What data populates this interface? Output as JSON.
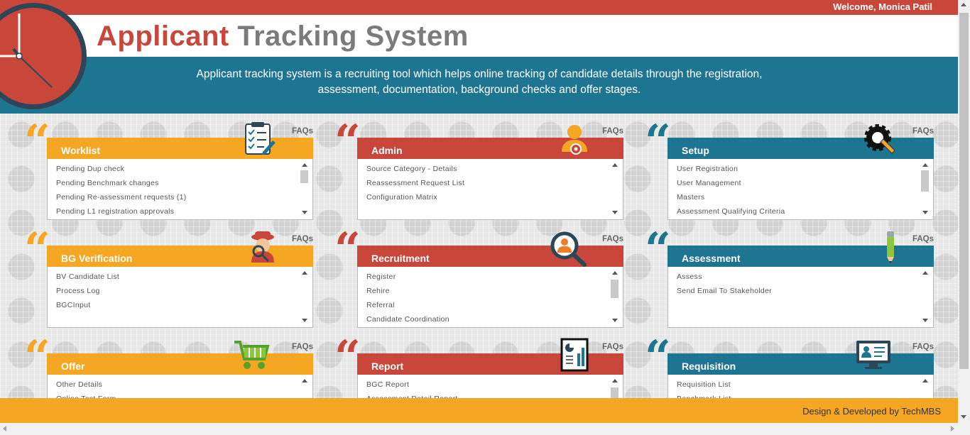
{
  "header": {
    "welcome": "Welcome, Monica Patil",
    "title_part1": "Applicant",
    "title_part2": "Tracking System",
    "description": "Applicant tracking system is a recruiting tool which helps online tracking of candidate details through the registration, assessment, documentation, background checks and offer stages."
  },
  "faqs_label": "FAQs",
  "panels": [
    {
      "title": "Worklist",
      "icon": "checklist-icon",
      "items": [
        "Pending Dup check",
        "Pending Benchmark changes",
        "Pending Re-assessment requests (1)",
        "Pending L1 registration approvals"
      ]
    },
    {
      "title": "Admin",
      "icon": "admin-user-gear-icon",
      "items": [
        "Source Category - Details",
        "Reassessment Request List",
        "Configuration Matrix"
      ]
    },
    {
      "title": "Setup",
      "icon": "gear-wrench-icon",
      "items": [
        "User Registration",
        "User Management",
        "Masters",
        "Assessment Qualifying Criteria"
      ]
    },
    {
      "title": "BG Verification",
      "icon": "detective-icon",
      "items": [
        "BV Candidate List",
        "Process Log",
        "BGCInput"
      ]
    },
    {
      "title": "Recruitment",
      "icon": "search-person-icon",
      "items": [
        "Register",
        "Rehire",
        "Referral",
        "Candidate Coordination"
      ]
    },
    {
      "title": "Assessment",
      "icon": "pencil-icon",
      "items": [
        "Assess",
        "Send Email To Stakeholder"
      ]
    },
    {
      "title": "Offer",
      "icon": "shopping-cart-icon",
      "items": [
        "Other Details",
        "Online Test Form"
      ]
    },
    {
      "title": "Report",
      "icon": "report-chart-icon",
      "items": [
        "BGC Report",
        "Assessment Detail Report"
      ]
    },
    {
      "title": "Requisition",
      "icon": "monitor-profile-icon",
      "items": [
        "Requisition List",
        "Benchmark List"
      ]
    }
  ],
  "footer": {
    "text": "Design & Developed by TechMBS"
  },
  "colors": {
    "orange": "#f5a623",
    "red": "#c8463a",
    "blue": "#1e7592",
    "dark": "#2d4656"
  }
}
